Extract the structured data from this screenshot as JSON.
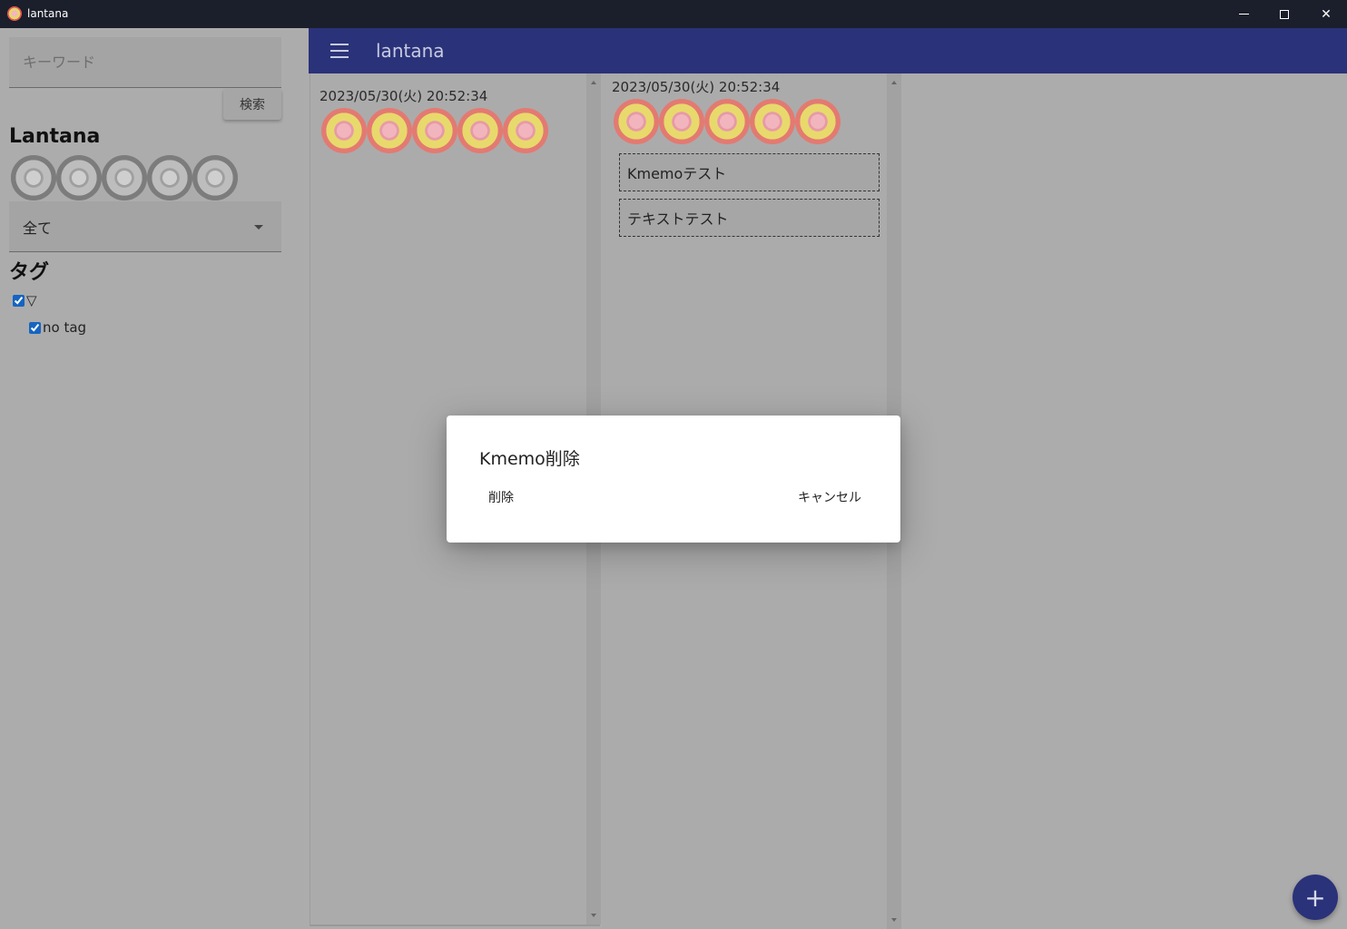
{
  "window": {
    "title": "lantana",
    "minimize_icon": "minimize-icon",
    "maximize_icon": "maximize-icon",
    "close_label": "✕"
  },
  "sidebar": {
    "search": {
      "placeholder": "キーワード",
      "value": ""
    },
    "search_button": "検索",
    "app_name": "Lantana",
    "filter_select": {
      "selected": "全て"
    },
    "tag_heading": "タグ",
    "tags": [
      {
        "label": "▽",
        "checked": true
      },
      {
        "label": "no tag",
        "checked": true
      }
    ]
  },
  "appbar": {
    "title": "lantana"
  },
  "columns": [
    {
      "timestamp": "2023/05/30(火) 20:52:34",
      "memos": []
    },
    {
      "timestamp": "2023/05/30(火) 20:52:34",
      "memos": [
        "Kmemoテスト",
        "テキストテスト"
      ]
    }
  ],
  "dialog": {
    "title": "Kmemo削除",
    "delete_label": "削除",
    "cancel_label": "キャンセル"
  },
  "fab": {
    "label": "+"
  },
  "colors": {
    "appbar": "#2a3279",
    "titlebar": "#1b1f2b",
    "overlay_background": "#acacac"
  }
}
